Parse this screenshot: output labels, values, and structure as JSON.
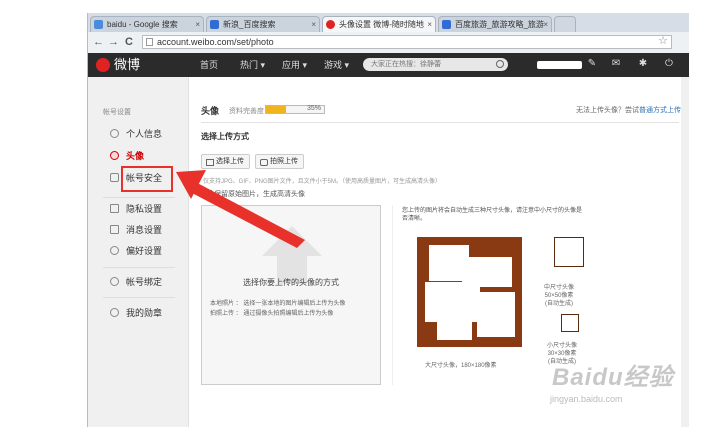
{
  "tabs": [
    {
      "label": "baidu - Google 搜索",
      "icon": "google-icon",
      "color": "#4a8bdc"
    },
    {
      "label": "新浪_百度搜索",
      "icon": "baidu-icon",
      "color": "#2f6cd6"
    },
    {
      "label": "头像设置 微博-随时随地",
      "icon": "weibo-icon",
      "color": "#e02222"
    },
    {
      "label": "百度旅游_旅游攻略_旅游",
      "icon": "baidu-icon",
      "color": "#2f6cd6"
    }
  ],
  "address": {
    "url": "account.weibo.com/set/photo"
  },
  "topnav": {
    "logo": "微博",
    "items": [
      "首页",
      "热门",
      "应用",
      "游戏"
    ],
    "search_placeholder": "大家正在热搜：徐静蕾"
  },
  "sidebar": {
    "heading": "帐号设置",
    "items": [
      {
        "label": "个人信息",
        "icon": "person-icon"
      },
      {
        "label": "头像",
        "icon": "avatar-icon"
      },
      {
        "label": "帐号安全",
        "icon": "shield-icon"
      },
      {
        "label": "隐私设置",
        "icon": "lock-icon"
      },
      {
        "label": "消息设置",
        "icon": "message-icon"
      },
      {
        "label": "偏好设置",
        "icon": "preference-icon"
      },
      {
        "label": "帐号绑定",
        "icon": "link-icon"
      },
      {
        "label": "我的勋章",
        "icon": "medal-icon"
      }
    ]
  },
  "main": {
    "title": "头像",
    "completeness_label": "资料完善度",
    "completeness": 0.35,
    "completeness_text": "35%",
    "help_prefix": "无法上传头像？尝试",
    "help_link": "普通方式上传",
    "section_title": "选择上传方式",
    "upload_button": "选择上传",
    "camera_button": "拍照上传",
    "format_hint": "仅支持JPG、GIF、PNG图片文件，且文件小于5M。（使用高质量图片，可生成高清头像）",
    "keep_original": "保留原始图片，生成高清头像",
    "upload_area_title": "选择你要上传的头像的方式",
    "upload_local": "本地照片 ： 选择一张本地的图片编辑后上传为头像",
    "upload_camera": "拍照上传 ： 通过摄像头拍照编辑后上传为头像",
    "preview_hint": "您上传的图片将会自动生成三种尺寸头像，请注意中小尺寸的头像是否清晰。",
    "big_caption": "大尺寸头像，180×180像素",
    "mid_caption": [
      "中尺寸头像",
      "50×50像素",
      "(自动生成)"
    ],
    "small_caption": [
      "小尺寸头像",
      "30×30像素",
      "(自动生成)"
    ]
  },
  "watermark": {
    "brand": "Baidu经验",
    "url": "jingyan.baidu.com"
  },
  "colors": {
    "accent": "#e8312a",
    "weibo_red": "#e02222",
    "nav_bg": "#2b2b2b"
  }
}
